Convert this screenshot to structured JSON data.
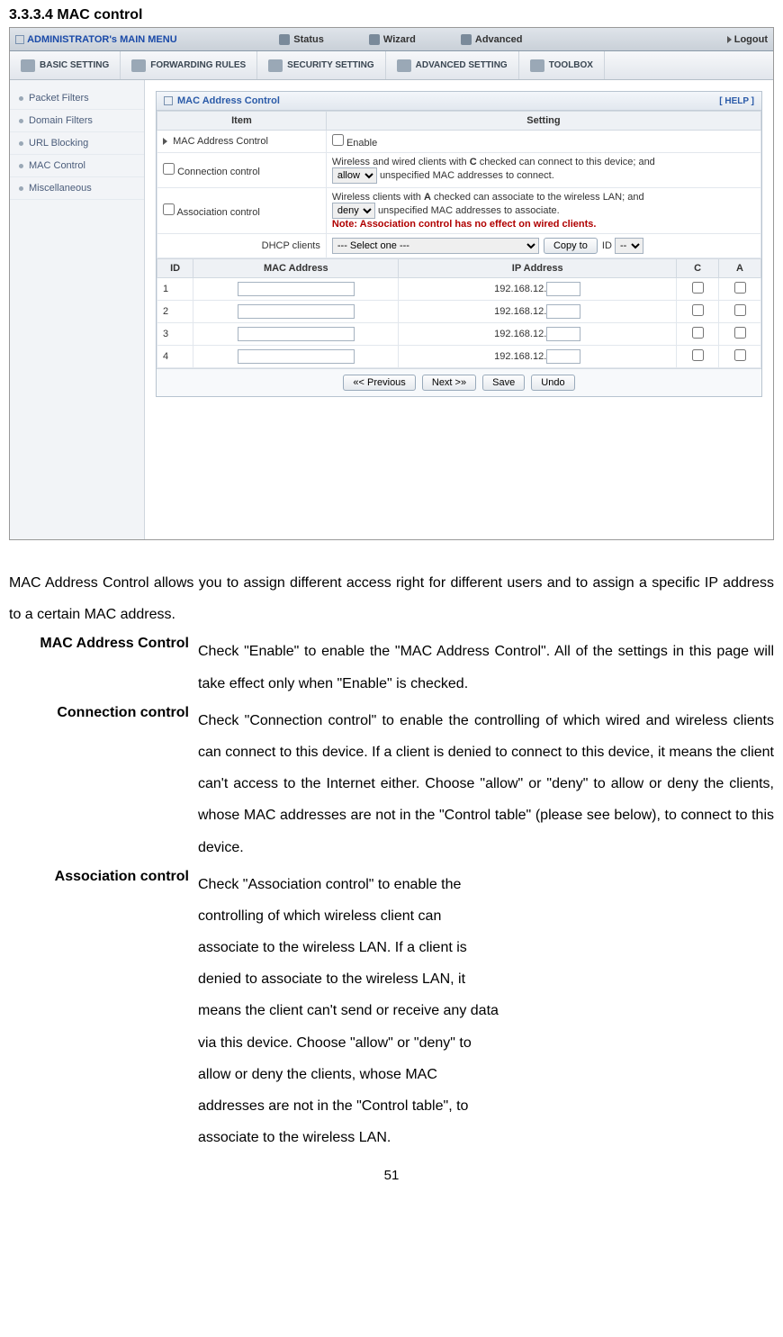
{
  "section_heading": "3.3.3.4 MAC control",
  "topnav": {
    "brand": "ADMINISTRATOR's MAIN MENU",
    "items": [
      "Status",
      "Wizard",
      "Advanced"
    ],
    "logout": "Logout"
  },
  "subnav": [
    "BASIC SETTING",
    "FORWARDING RULES",
    "SECURITY SETTING",
    "ADVANCED SETTING",
    "TOOLBOX"
  ],
  "sidebar": [
    "Packet Filters",
    "Domain Filters",
    "URL Blocking",
    "MAC Control",
    "Miscellaneous"
  ],
  "panel": {
    "title": "MAC Address Control",
    "help": "[ HELP ]",
    "cols": {
      "item": "Item",
      "setting": "Setting"
    },
    "rows": {
      "mac": {
        "label": "MAC Address Control",
        "val": "Enable"
      },
      "conn": {
        "label": "Connection control",
        "text_a": "Wireless and wired clients with",
        "bold_c": "C",
        "text_b": "checked can connect to this device; and",
        "select": "allow",
        "text_c": "unspecified MAC addresses to connect."
      },
      "assoc": {
        "label": "Association control",
        "text_a": "Wireless clients with",
        "bold_a": "A",
        "text_b": "checked can associate to the wireless LAN; and",
        "select": "deny",
        "text_c": "unspecified MAC addresses to associate.",
        "note": "Note: Association control has no effect on wired clients."
      },
      "dhcp": {
        "label": "DHCP clients",
        "select": "--- Select one ---",
        "copy_btn": "Copy to",
        "id_label": "ID",
        "id_select": "--"
      }
    },
    "tbl": {
      "headers": {
        "id": "ID",
        "mac": "MAC Address",
        "ip": "IP Address",
        "c": "C",
        "a": "A"
      },
      "ip_prefix": "192.168.12.",
      "rows": [
        1,
        2,
        3,
        4
      ]
    },
    "buttons": {
      "prev": "«< Previous",
      "next": "Next >»",
      "save": "Save",
      "undo": "Undo"
    }
  },
  "doc": {
    "intro": "MAC Address Control allows you to assign different access right for different users and to assign a specific IP address to a certain MAC address.",
    "mac_label": "MAC Address Control",
    "mac_body": "Check \"Enable\" to enable the \"MAC Address Control\". All of the settings in this page will take effect only when \"Enable\" is checked.",
    "conn_label": "Connection control",
    "conn_body": "Check \"Connection control\" to enable the controlling of which wired and wireless clients can connect to this device. If a client is denied to connect to this device, it means the client can't access to the Internet either. Choose \"allow\" or \"deny\" to allow or deny the clients, whose MAC addresses are not in the \"Control table\" (please see below), to connect to this device.",
    "assoc_label": "Association control",
    "assoc_lines": [
      "Check \"Association control\" to enable the",
      "controlling of which wireless client can",
      "associate to the wireless LAN. If a client is",
      "denied to associate to the wireless LAN, it",
      "means the client can't send or receive any data",
      "via this device. Choose \"allow\" or \"deny\" to",
      "allow or deny the clients, whose MAC",
      "addresses are not in the \"Control table\", to",
      "associate to the wireless LAN."
    ]
  },
  "page_number": "51"
}
